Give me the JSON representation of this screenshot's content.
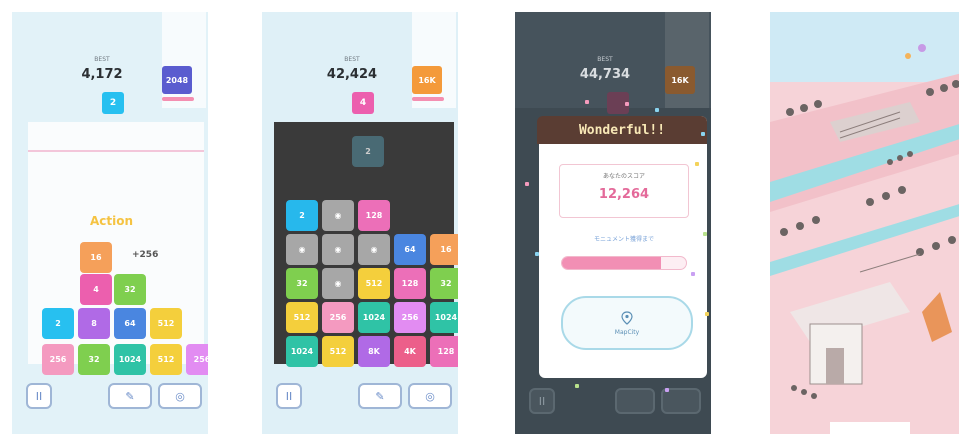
{
  "panels": [
    {
      "best_label": "BEST",
      "score": "4,172",
      "next_tile": "2",
      "goal_tile": "2048",
      "combo_text": "Action",
      "plus_text": "+256",
      "tiles": [
        {
          "label": "16",
          "color": "#f5a05a"
        },
        {
          "label": "4",
          "color": "#ec5fae"
        },
        {
          "label": "32",
          "color": "#7fcf4f"
        },
        {
          "label": "2",
          "color": "#27c0f0"
        },
        {
          "label": "8",
          "color": "#b06ae6"
        },
        {
          "label": "64",
          "color": "#4a86e0"
        },
        {
          "label": "512",
          "color": "#f4cf3c"
        },
        {
          "label": "256",
          "color": "#f49ac0"
        },
        {
          "label": "32",
          "color": "#7fcf4f"
        },
        {
          "label": "1024",
          "color": "#2fc3a6"
        },
        {
          "label": "512",
          "color": "#f4cf3c"
        },
        {
          "label": "256",
          "color": "#e28cf2"
        }
      ],
      "pause_label": "II",
      "hammer_label": "✎",
      "swap_label": "◎"
    },
    {
      "best_label": "BEST",
      "score": "42,424",
      "next_tile": "4",
      "goal_tile": "16K",
      "ghost_tile": "2",
      "tiles": [
        {
          "label": "2",
          "color": "#27b8ec"
        },
        {
          "label": "◉",
          "color": "#a7a7a7"
        },
        {
          "label": "128",
          "color": "#ec6fb8"
        },
        {
          "label": "◉",
          "color": "#a7a7a7"
        },
        {
          "label": "◉",
          "color": "#a7a7a7"
        },
        {
          "label": "◉",
          "color": "#a7a7a7"
        },
        {
          "label": "64",
          "color": "#4a86e0"
        },
        {
          "label": "16",
          "color": "#f5a05a"
        },
        {
          "label": "32",
          "color": "#7fcf4f"
        },
        {
          "label": "◉",
          "color": "#a7a7a7"
        },
        {
          "label": "512",
          "color": "#f4cf3c"
        },
        {
          "label": "128",
          "color": "#ec6fb8"
        },
        {
          "label": "32",
          "color": "#7fcf4f"
        },
        {
          "label": "512",
          "color": "#f4cf3c"
        },
        {
          "label": "256",
          "color": "#f49ac0"
        },
        {
          "label": "1024",
          "color": "#2fc3a6"
        },
        {
          "label": "256",
          "color": "#e28cf2"
        },
        {
          "label": "1024",
          "color": "#2fc3a6"
        },
        {
          "label": "1024",
          "color": "#2fc3a6"
        },
        {
          "label": "512",
          "color": "#f4cf3c"
        },
        {
          "label": "8K",
          "color": "#b06ae6"
        },
        {
          "label": "4K",
          "color": "#ec5f8a"
        },
        {
          "label": "128",
          "color": "#ec6fb8"
        }
      ],
      "pause_label": "II",
      "swap_label": "◎"
    },
    {
      "best_label": "BEST",
      "score": "44,734",
      "next_tile": "",
      "goal_tile": "16K",
      "dialog_title": "Wonderful!!",
      "score_label": "あなたのスコア",
      "result_score": "12,264",
      "reward_label": "モニュメント獲得まで",
      "progress": 0.8,
      "map_label": "MapCity"
    }
  ],
  "colors": {
    "accent": "#f28fb4",
    "dialog_header": "#5a3d33"
  }
}
